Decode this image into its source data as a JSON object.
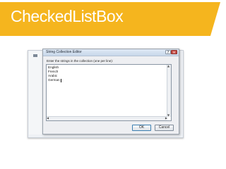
{
  "slide": {
    "title": "CheckedListBox",
    "accent_color": "#f5b51e"
  },
  "dialog": {
    "title": "String Collection Editor",
    "prompt": "Enter the strings in the collection (one per line):",
    "lines": [
      "English",
      "French",
      "Arabic",
      "German"
    ],
    "ok_label": "OK",
    "cancel_label": "Cancel",
    "help_glyph": "?",
    "close_glyph": "×"
  }
}
